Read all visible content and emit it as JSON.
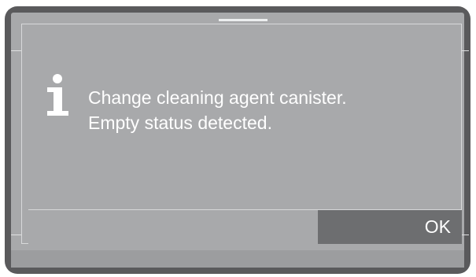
{
  "dialog": {
    "icon": "info-icon",
    "message_lines": [
      "Change cleaning agent canister.",
      "Empty status detected."
    ],
    "ok_label": "OK"
  },
  "colors": {
    "bezel": "#5a5a5c",
    "screen": "#a8a9ab",
    "ok_button": "#6d6e70",
    "text": "#ffffff"
  }
}
